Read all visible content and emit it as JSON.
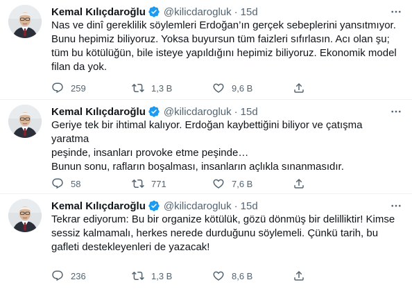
{
  "tweets": [
    {
      "author": "Kemal Kılıçdaroğlu",
      "handle": "@kilicdarogluk",
      "separator": "·",
      "time": "15d",
      "lines": [
        "Nas ve dinî gereklilik söylemleri Erdoğan’ın gerçek sebeplerini yansıtmıyor.",
        "Bunu hepimiz biliyoruz. Yoksa buyursun tüm faizleri sıfırlasın. Acı olan şu;",
        "tüm bu kötülüğün, bile isteye yapıldığını hepimiz biliyoruz. Ekonomik model",
        "filan da yok."
      ],
      "replies": "259",
      "retweets": "1,3 B",
      "likes": "9,6 B"
    },
    {
      "author": "Kemal Kılıçdaroğlu",
      "handle": "@kilicdarogluk",
      "separator": "·",
      "time": "15d",
      "lines": [
        "Geriye tek bir ihtimal kalıyor. Erdoğan kaybettiğini biliyor ve çatışma yaratma",
        "peşinde, insanları provoke etme peşinde…",
        "Bunun sonu, rafların boşalması, insanların açlıkla sınanmasıdır."
      ],
      "replies": "58",
      "retweets": "771",
      "likes": "7,6 B"
    },
    {
      "author": "Kemal Kılıçdaroğlu",
      "handle": "@kilicdarogluk",
      "separator": "·",
      "time": "15d",
      "lines": [
        "Tekrar ediyorum: Bu bir organize kötülük, gözü dönmüş bir delilliktir! Kimse",
        "sessiz kalmamalı, herkes nerede durduğunu söylemeli. Çünkü tarih, bu",
        "gafleti destekleyenleri de yazacak!"
      ],
      "replies": "236",
      "retweets": "1,3 B",
      "likes": "8,6 B"
    }
  ],
  "colors": {
    "text": "#0f1419",
    "secondary": "#536471",
    "verified": "#1d9bf0",
    "divider": "#eff3f4"
  },
  "icons": {
    "reply": "reply-icon",
    "retweet": "retweet-icon",
    "like": "heart-icon",
    "share": "share-icon",
    "more": "more-options-icon",
    "verified": "verified-badge-icon"
  }
}
